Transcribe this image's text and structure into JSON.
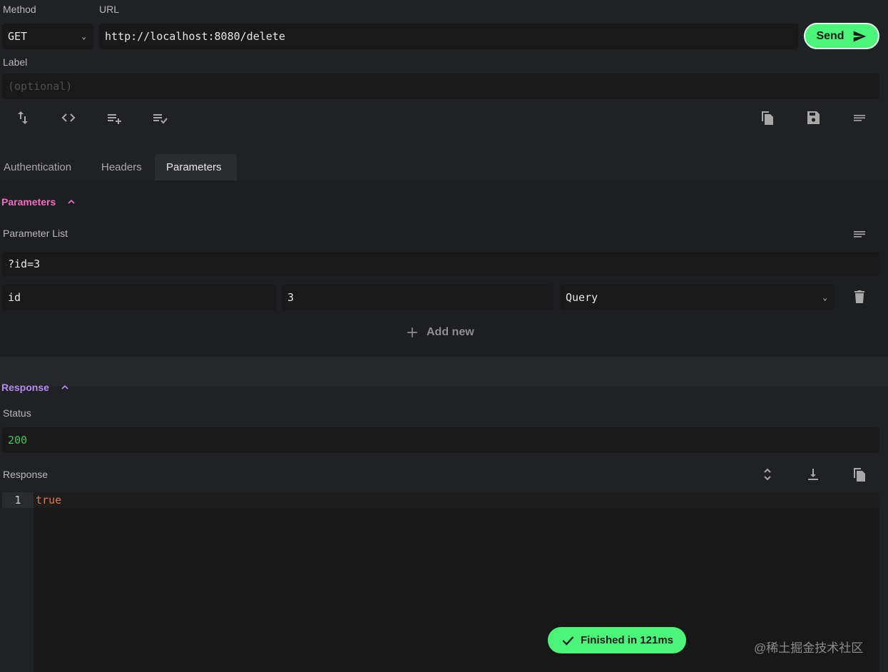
{
  "request": {
    "method_label": "Method",
    "url_label": "URL",
    "method_value": "GET",
    "url_value": "http://localhost:8080/delete",
    "send_label": "Send",
    "label_label": "Label",
    "label_placeholder": "(optional)"
  },
  "toolbar": {
    "left_icons": [
      "swap-vertical-icon",
      "code-icon",
      "playlist-add-icon",
      "playlist-check-icon"
    ],
    "right_icons": [
      "copy-icon",
      "save-icon",
      "notes-icon"
    ]
  },
  "tabs": [
    {
      "label": "Authentication",
      "active": false
    },
    {
      "label": "Headers",
      "active": false
    },
    {
      "label": "Parameters",
      "active": true
    }
  ],
  "parameters": {
    "section_title": "Parameters",
    "list_label": "Parameter List",
    "raw": "?id=3",
    "rows": [
      {
        "key": "id",
        "value": "3",
        "type": "Query"
      }
    ],
    "add_new_label": "Add new"
  },
  "response": {
    "section_title": "Response",
    "status_label": "Status",
    "status_value": "200",
    "body_label": "Response",
    "line_number": "1",
    "body": "true"
  },
  "toast": {
    "text": "Finished in 121ms"
  },
  "watermark": "@稀土掘金技术社区",
  "colors": {
    "accent_green": "#4bf57a",
    "parameters_pink": "#f06cc0",
    "response_purple": "#b58cf3",
    "status_green": "#3fc454",
    "boolean_orange": "#e07a4b"
  }
}
